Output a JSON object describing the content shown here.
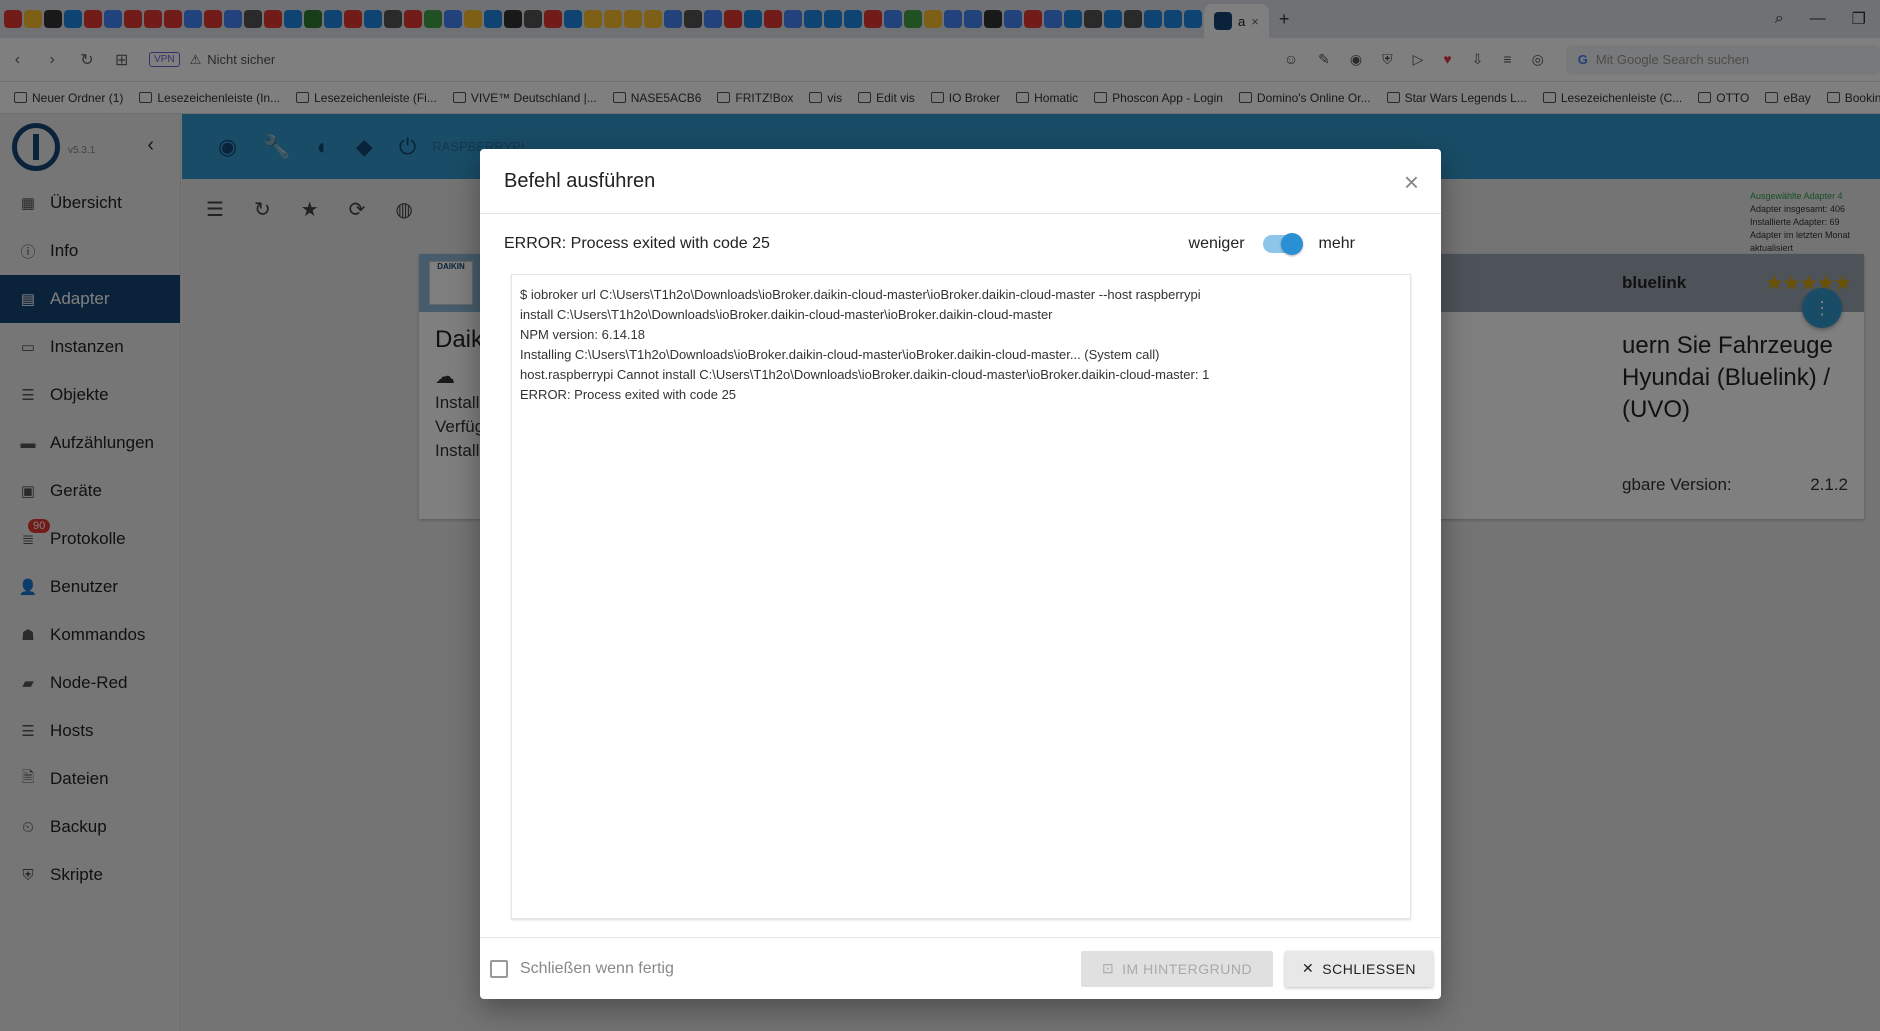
{
  "browser": {
    "active_tab_title": "a",
    "vpn_label": "VPN",
    "url_text": "Nicht sicher",
    "search_placeholder": "Mit Google Search suchen",
    "bookmarks": [
      "Neuer Ordner (1)",
      "Lesezeichenleiste (In...",
      "Lesezeichenleiste (Fi...",
      "VIVE™ Deutschland |...",
      "NASE5ACB6",
      "FRITZ!Box",
      "vis",
      "Edit vis",
      "IO Broker",
      "Homatic",
      "Phoscon App - Login",
      "Domino's Online Or...",
      "Star Wars Legends L...",
      "Lesezeichenleiste (C...",
      "OTTO",
      "eBay",
      "Booking.com"
    ]
  },
  "sidebar": {
    "version": "v5.3.1",
    "items": [
      {
        "label": "Übersicht",
        "icon": "grid-icon"
      },
      {
        "label": "Info",
        "icon": "info-icon"
      },
      {
        "label": "Adapter",
        "icon": "store-icon"
      },
      {
        "label": "Instanzen",
        "icon": "instances-icon"
      },
      {
        "label": "Objekte",
        "icon": "list-icon"
      },
      {
        "label": "Aufzählungen",
        "icon": "enum-icon"
      },
      {
        "label": "Geräte",
        "icon": "devices-icon"
      },
      {
        "label": "Protokolle",
        "icon": "log-icon"
      },
      {
        "label": "Benutzer",
        "icon": "user-icon"
      },
      {
        "label": "Kommandos",
        "icon": "intro-icon"
      },
      {
        "label": "Node-Red",
        "icon": "node-red-icon"
      },
      {
        "label": "Hosts",
        "icon": "hosts-icon"
      },
      {
        "label": "Dateien",
        "icon": "files-icon"
      },
      {
        "label": "Backup",
        "icon": "backup-icon"
      },
      {
        "label": "Skripte",
        "icon": "javascript-icon"
      }
    ],
    "log_badge": "90"
  },
  "header": {
    "host": "RASPBERRYPI"
  },
  "right_info": {
    "selected": "Ausgewählte Adapter 4",
    "total": "Adapter insgesamt: 406",
    "installed": "Installierte Adapter: 69",
    "updated": "Adapter im letzten Monat aktualisiert"
  },
  "cards": {
    "left": {
      "logo_text": "DAIKIN",
      "title": "Daik",
      "lines": [
        "Install",
        "Verfüg",
        "Install"
      ]
    },
    "right": {
      "name": "bluelink",
      "stars": "★★★★★",
      "desc": "uern Sie Fahrzeuge Hyundai (Bluelink) / (UVO)",
      "version_label": "gbare Version:",
      "version_value": "2.1.2"
    }
  },
  "dialog": {
    "title": "Befehl ausführen",
    "status": "ERROR: Process exited with code 25",
    "toggle_less": "weniger",
    "toggle_more": "mehr",
    "log": [
      "$ iobroker url C:\\Users\\T1h2o\\Downloads\\ioBroker.daikin-cloud-master\\ioBroker.daikin-cloud-master --host raspberrypi",
      "install C:\\Users\\T1h2o\\Downloads\\ioBroker.daikin-cloud-master\\ioBroker.daikin-cloud-master",
      "NPM version: 6.14.18",
      "Installing C:\\Users\\T1h2o\\Downloads\\ioBroker.daikin-cloud-master\\ioBroker.daikin-cloud-master... (System call)",
      "host.raspberrypi Cannot install C:\\Users\\T1h2o\\Downloads\\ioBroker.daikin-cloud-master\\ioBroker.daikin-cloud-master: 1",
      "ERROR: Process exited with code 25"
    ],
    "close_when_done_label": "Schließen wenn fertig",
    "background_button": "IM HINTERGRUND",
    "close_button": "SCHLIESSEN"
  }
}
